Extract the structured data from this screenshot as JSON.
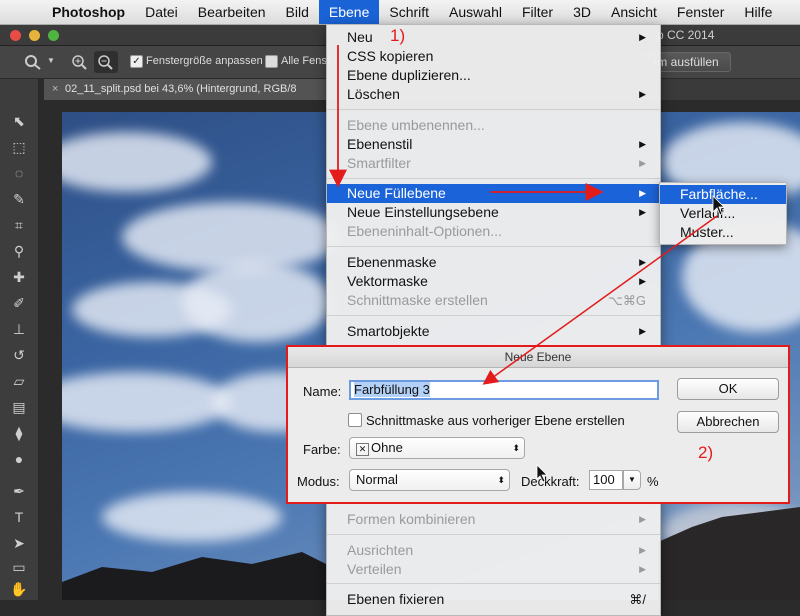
{
  "menubar": {
    "app": "Photoshop",
    "items": [
      "Datei",
      "Bearbeiten",
      "Bild",
      "Ebene",
      "Schrift",
      "Auswahl",
      "Filter",
      "3D",
      "Ansicht",
      "Fenster",
      "Hilfe"
    ]
  },
  "window": {
    "title": "p CC 2014"
  },
  "options": {
    "checkbox1": "Fenstergröße anpassen",
    "checkbox2": "Alle Fenst",
    "fill_button": "rm ausfüllen"
  },
  "document": {
    "tab": "02_11_split.psd bei 43,6% (Hintergrund, RGB/8"
  },
  "ebene_menu": {
    "items": [
      {
        "label": "Neu",
        "arrow": "▶"
      },
      {
        "label": "CSS kopieren"
      },
      {
        "label": "Ebene duplizieren..."
      },
      {
        "label": "Löschen",
        "arrow": "▶"
      },
      {
        "label": "Ebene umbenennen..."
      },
      {
        "label": "Ebenenstil",
        "arrow": "▶"
      },
      {
        "label": "Smartfilter",
        "arrow": "▶"
      },
      {
        "label": "Neue Füllebene",
        "arrow": "▶"
      },
      {
        "label": "Neue Einstellungsebene",
        "arrow": "▶"
      },
      {
        "label": "Ebeneninhalt-Optionen..."
      },
      {
        "label": "Ebenenmaske",
        "arrow": "▶"
      },
      {
        "label": "Vektormaske",
        "arrow": "▶"
      },
      {
        "label": "Schnittmaske erstellen",
        "shortcut": "⌥⌘G"
      },
      {
        "label": "Smartobjekte",
        "arrow": "▶"
      },
      {
        "label": "Formen kombinieren",
        "arrow": "▶"
      },
      {
        "label": "Ausrichten",
        "arrow": "▶"
      },
      {
        "label": "Verteilen",
        "arrow": "▶"
      },
      {
        "label": "Ebenen fixieren",
        "shortcut": "⌘/"
      }
    ]
  },
  "submenu": {
    "items": [
      "Farbfläche...",
      "Verlauf...",
      "Muster..."
    ]
  },
  "dialog": {
    "title": "Neue Ebene",
    "name_label": "Name:",
    "name_value": "Farbfüllung 3",
    "clip_label": "Schnittmaske aus vorheriger Ebene erstellen",
    "color_label": "Farbe:",
    "color_icon": "✕",
    "color_value": "Ohne",
    "mode_label": "Modus:",
    "mode_value": "Normal",
    "opacity_label": "Deckkraft:",
    "opacity_value": "100",
    "opacity_unit": "%",
    "ok": "OK",
    "cancel": "Abbrechen"
  },
  "annotations": {
    "step1": "1)",
    "step2": "2)"
  },
  "colors": {
    "highlight": "#1b63d8",
    "annotation": "#e31b1b"
  }
}
